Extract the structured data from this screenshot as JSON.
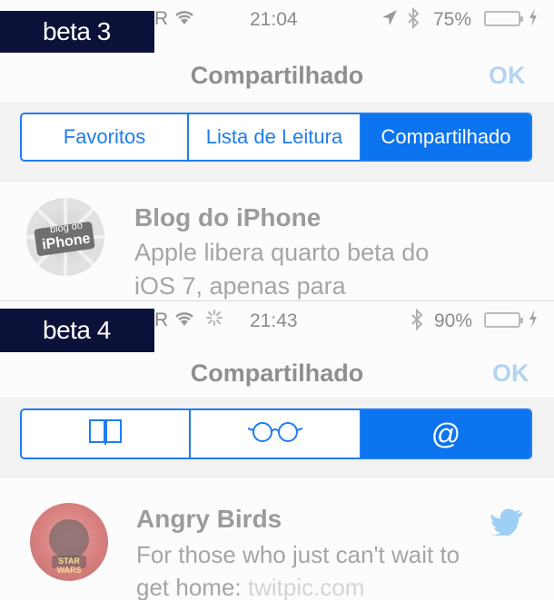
{
  "beta3": {
    "label": "beta 3",
    "status": {
      "carrier": "R",
      "time": "21:04",
      "battery_pct": "75%",
      "battery_level": 0.75
    },
    "navbar": {
      "title": "Compartilhado",
      "ok_label": "OK"
    },
    "segments": [
      {
        "label": "Favoritos",
        "active": false
      },
      {
        "label": "Lista de Leitura",
        "active": false
      },
      {
        "label": "Compartilhado",
        "active": true
      }
    ],
    "row": {
      "avatar_text_line1": "blog do",
      "avatar_text_line2": "iPhone",
      "title": "Blog do iPhone",
      "text_line1": "Apple libera quarto beta do",
      "text_line2": "iOS 7, apenas para"
    }
  },
  "beta4": {
    "label": "beta 4",
    "status": {
      "carrier": "R",
      "time": "21:43",
      "battery_pct": "90%",
      "battery_level": 0.9
    },
    "navbar": {
      "title": "Compartilhado",
      "ok_label": "OK"
    },
    "segments": [
      {
        "icon": "book-icon",
        "active": false
      },
      {
        "icon": "glasses-icon",
        "active": false
      },
      {
        "icon": "at-icon",
        "glyph": "@",
        "active": true
      }
    ],
    "row": {
      "avatar_text": "STAR WARS",
      "title": "Angry Birds",
      "text_line1": "For those who just can't wait to",
      "text_line2": "get home: ",
      "link": "twitpic.com"
    }
  },
  "colors": {
    "accent": "#1e7cf2",
    "label_bg": "#0b1138",
    "twitter": "#55acee"
  }
}
